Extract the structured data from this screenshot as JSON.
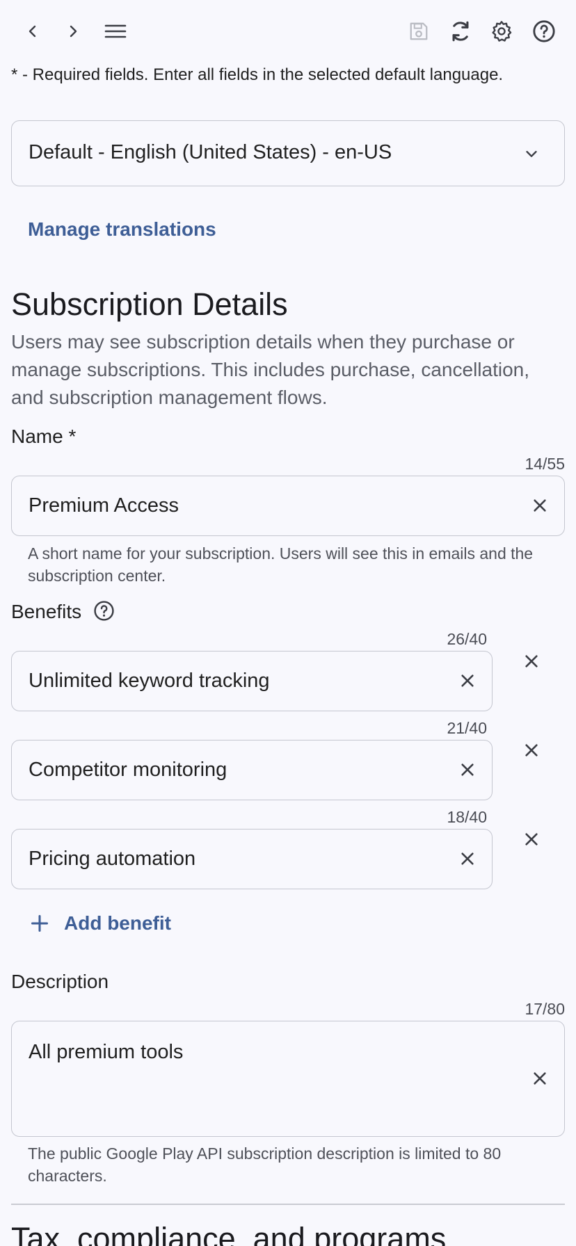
{
  "toolbar": {
    "back_icon": "chevron-left-icon",
    "forward_icon": "chevron-right-icon",
    "menu_icon": "menu-icon",
    "save_icon": "save-icon",
    "refresh_icon": "refresh-icon",
    "settings_icon": "gear-icon",
    "help_icon": "help-icon"
  },
  "required_note": "* - Required fields. Enter all fields in the selected default language.",
  "language_select": {
    "value": "Default - English (United States) - en-US"
  },
  "manage_translations": "Manage translations",
  "subscription_details": {
    "title": "Subscription Details",
    "description": "Users may see subscription details when they purchase or manage subscriptions. This includes purchase, cancellation, and subscription management flows."
  },
  "name_field": {
    "label": "Name *",
    "counter": "14/55",
    "value": "Premium Access",
    "helper": "A short name for your subscription. Users will see this in emails and the subscription center."
  },
  "benefits": {
    "label": "Benefits",
    "items": [
      {
        "counter": "26/40",
        "value": "Unlimited keyword tracking"
      },
      {
        "counter": "21/40",
        "value": "Competitor monitoring"
      },
      {
        "counter": "18/40",
        "value": "Pricing automation"
      }
    ],
    "add_label": "Add benefit"
  },
  "description_field": {
    "label": "Description",
    "counter": "17/80",
    "value": "All premium tools",
    "helper": "The public Google Play API subscription description is limited to 80 characters."
  },
  "next_section_title": "Tax, compliance, and programs",
  "colors": {
    "background": "#f8f8fd",
    "accent": "#3e5e96",
    "border": "#c4c6cf"
  }
}
